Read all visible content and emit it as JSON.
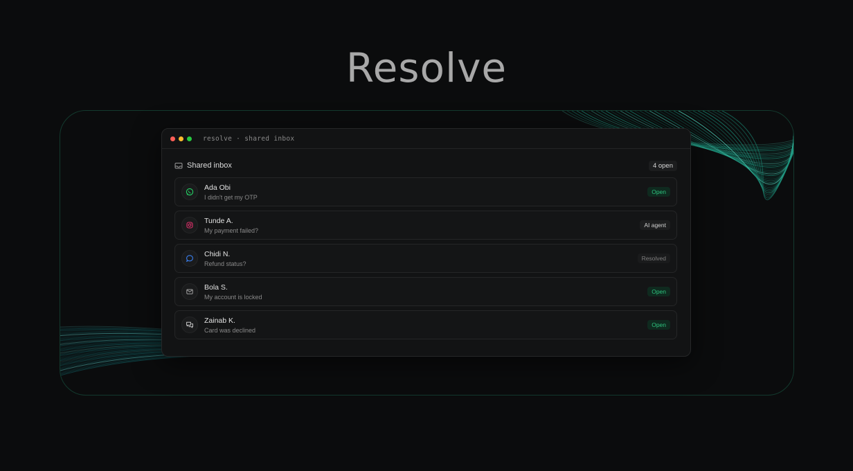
{
  "hero": {
    "title": "Resolve"
  },
  "window": {
    "title": "resolve · shared inbox"
  },
  "inbox": {
    "title": "Shared inbox",
    "open_count": "4 open",
    "items": [
      {
        "name": "Ada Obi",
        "message": "I didn't get my OTP",
        "status": "Open",
        "channel_icon": "whatsapp-icon",
        "channel_color": "#25d366"
      },
      {
        "name": "Tunde A.",
        "message": "My payment failed?",
        "status": "AI agent",
        "channel_icon": "instagram-icon",
        "channel_color": "#e1306c"
      },
      {
        "name": "Chidi N.",
        "message": "Refund status?",
        "status": "Resolved",
        "channel_icon": "chat-bubble-icon",
        "channel_color": "#3b82f6"
      },
      {
        "name": "Bola S.",
        "message": "My account is locked",
        "status": "Open",
        "channel_icon": "mail-icon",
        "channel_color": "#a0a0a0"
      },
      {
        "name": "Zainab K.",
        "message": "Card was declined",
        "status": "Open",
        "channel_icon": "messages-icon",
        "channel_color": "#c8c8c8"
      }
    ]
  },
  "colors": {
    "background": "#0b0c0d",
    "accent_teal": "#1fa08a",
    "status_open": "#2ec27e"
  }
}
